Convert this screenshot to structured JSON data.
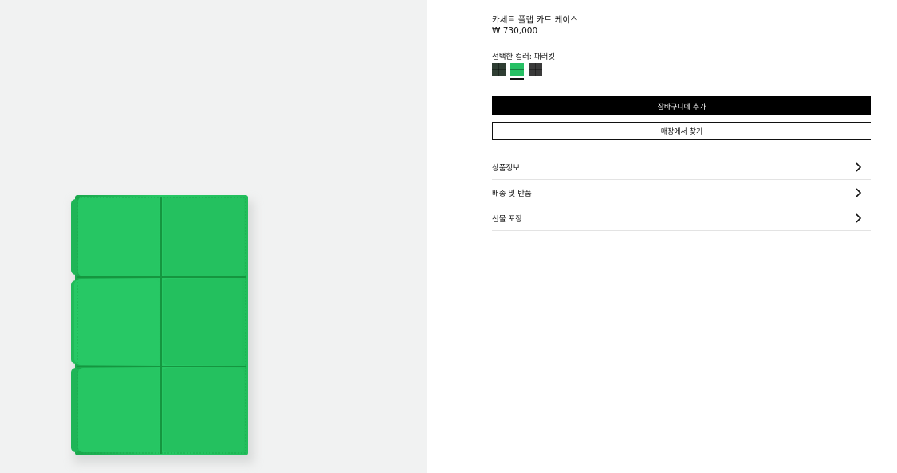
{
  "product": {
    "title": "카세트 플랩 카드 케이스",
    "price": "₩ 730,000"
  },
  "color": {
    "selected_label": "선택한 컬러: 패러킷",
    "swatches": [
      {
        "name": "dark-green",
        "color": "#2f3e33",
        "selected": false
      },
      {
        "name": "parakeet",
        "color": "#27c064",
        "selected": true
      },
      {
        "name": "black",
        "color": "#3a3a3a",
        "selected": false
      }
    ]
  },
  "buttons": {
    "add_to_cart": "장바구니에 추가",
    "find_store": "매장에서 찾기"
  },
  "accordion": [
    {
      "label": "상품정보"
    },
    {
      "label": "배송 및 반품"
    },
    {
      "label": "선물 포장"
    }
  ],
  "colors": {
    "image_bg": "#f1f2f2",
    "product_green": "#21c35c",
    "text": "#111111"
  }
}
